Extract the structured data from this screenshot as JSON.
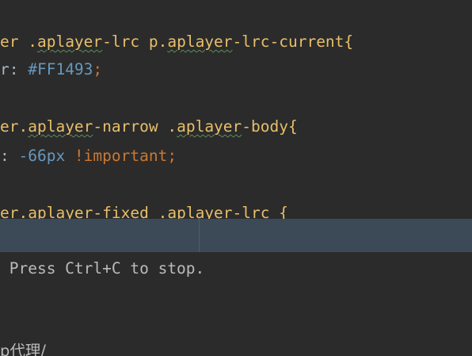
{
  "editor": {
    "lines": [
      {
        "parts": [
          {
            "text": "er .",
            "kind": "tok-sel"
          },
          {
            "text": "aplayer",
            "kind": "tok-cls squig"
          },
          {
            "text": "-lrc p.",
            "kind": "tok-cls"
          },
          {
            "text": "aplayer",
            "kind": "tok-cls squig"
          },
          {
            "text": "-lrc-current{",
            "kind": "tok-cls"
          }
        ]
      },
      {
        "parts": [
          {
            "text": "r: ",
            "kind": "tok-txt"
          },
          {
            "text": "#FF1493",
            "kind": "tok-hex"
          },
          {
            "text": ";",
            "kind": "tok-kw"
          }
        ]
      },
      {
        "parts": [
          {
            "text": "er.",
            "kind": "tok-sel"
          },
          {
            "text": "aplayer",
            "kind": "tok-cls squig"
          },
          {
            "text": "-narrow .",
            "kind": "tok-cls"
          },
          {
            "text": "aplayer",
            "kind": "tok-cls squig"
          },
          {
            "text": "-body{",
            "kind": "tok-cls"
          }
        ]
      },
      {
        "parts": [
          {
            "text": ": ",
            "kind": "tok-txt"
          },
          {
            "text": "-66px",
            "kind": "tok-num"
          },
          {
            "text": " !important",
            "kind": "tok-kw"
          },
          {
            "text": ";",
            "kind": "tok-kw"
          }
        ]
      },
      {
        "parts": [
          {
            "text": "er.",
            "kind": "tok-sel"
          },
          {
            "text": "aplayer",
            "kind": "tok-cls squig"
          },
          {
            "text": "-fixed .",
            "kind": "tok-cls"
          },
          {
            "text": "aplayer",
            "kind": "tok-cls squig"
          },
          {
            "text": "-lrc {",
            "kind": "tok-cls"
          }
        ]
      }
    ]
  },
  "terminal": {
    "stop_hint": " Press Ctrl+C to stop.",
    "proxy_line": "p代理/"
  }
}
